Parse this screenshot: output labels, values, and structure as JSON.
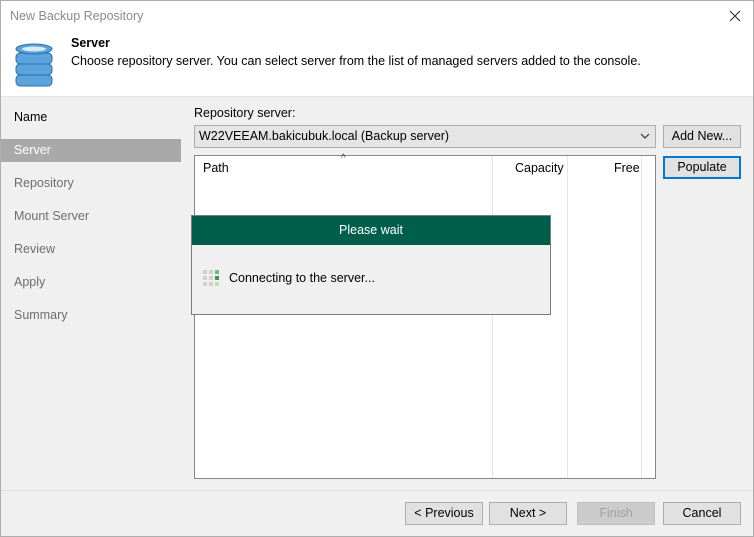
{
  "window": {
    "title": "New Backup Repository"
  },
  "header": {
    "title": "Server",
    "description": "Choose repository server. You can select server from the list of managed servers added to the console."
  },
  "steps": [
    {
      "label": "Name",
      "state": "done"
    },
    {
      "label": "Server",
      "state": "active"
    },
    {
      "label": "Repository",
      "state": "pending"
    },
    {
      "label": "Mount Server",
      "state": "pending"
    },
    {
      "label": "Review",
      "state": "pending"
    },
    {
      "label": "Apply",
      "state": "pending"
    },
    {
      "label": "Summary",
      "state": "pending"
    }
  ],
  "server": {
    "label": "Repository server:",
    "selected": "W22VEEAM.bakicubuk.local (Backup server)",
    "add_new": "Add New...",
    "populate": "Populate"
  },
  "table": {
    "columns": [
      "Path",
      "Capacity",
      "Free"
    ]
  },
  "wait_dialog": {
    "title": "Please wait",
    "message": "Connecting to the server..."
  },
  "buttons": {
    "previous": "< Previous",
    "next": "Next >",
    "finish": "Finish",
    "cancel": "Cancel"
  },
  "colors": {
    "accent_green": "#005f4b",
    "focus_blue": "#0078d7",
    "active_step": "#a9a9a9",
    "db_icon": "#4d9ad6"
  }
}
